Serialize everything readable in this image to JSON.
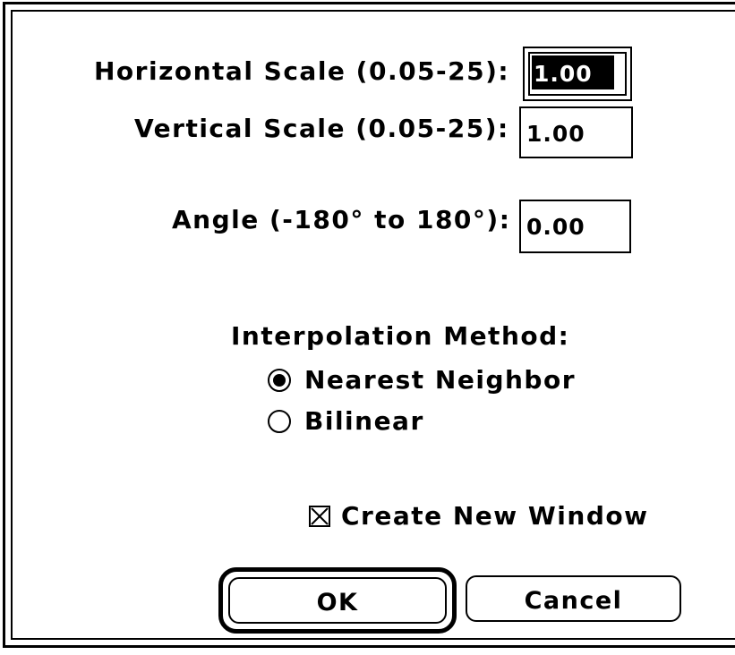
{
  "dialog": {
    "horizontal_scale": {
      "label": "Horizontal Scale (0.05-25):",
      "value": "1.00"
    },
    "vertical_scale": {
      "label": "Vertical Scale (0.05-25):",
      "value": "1.00"
    },
    "angle": {
      "label": "Angle (-180° to 180°):",
      "value": "0.00"
    },
    "interpolation": {
      "heading": "Interpolation Method:",
      "options": [
        {
          "label": "Nearest Neighbor",
          "selected": true
        },
        {
          "label": "Bilinear",
          "selected": false
        }
      ]
    },
    "create_new_window": {
      "label": "Create New Window",
      "checked": true
    },
    "buttons": {
      "ok": "OK",
      "cancel": "Cancel"
    }
  }
}
